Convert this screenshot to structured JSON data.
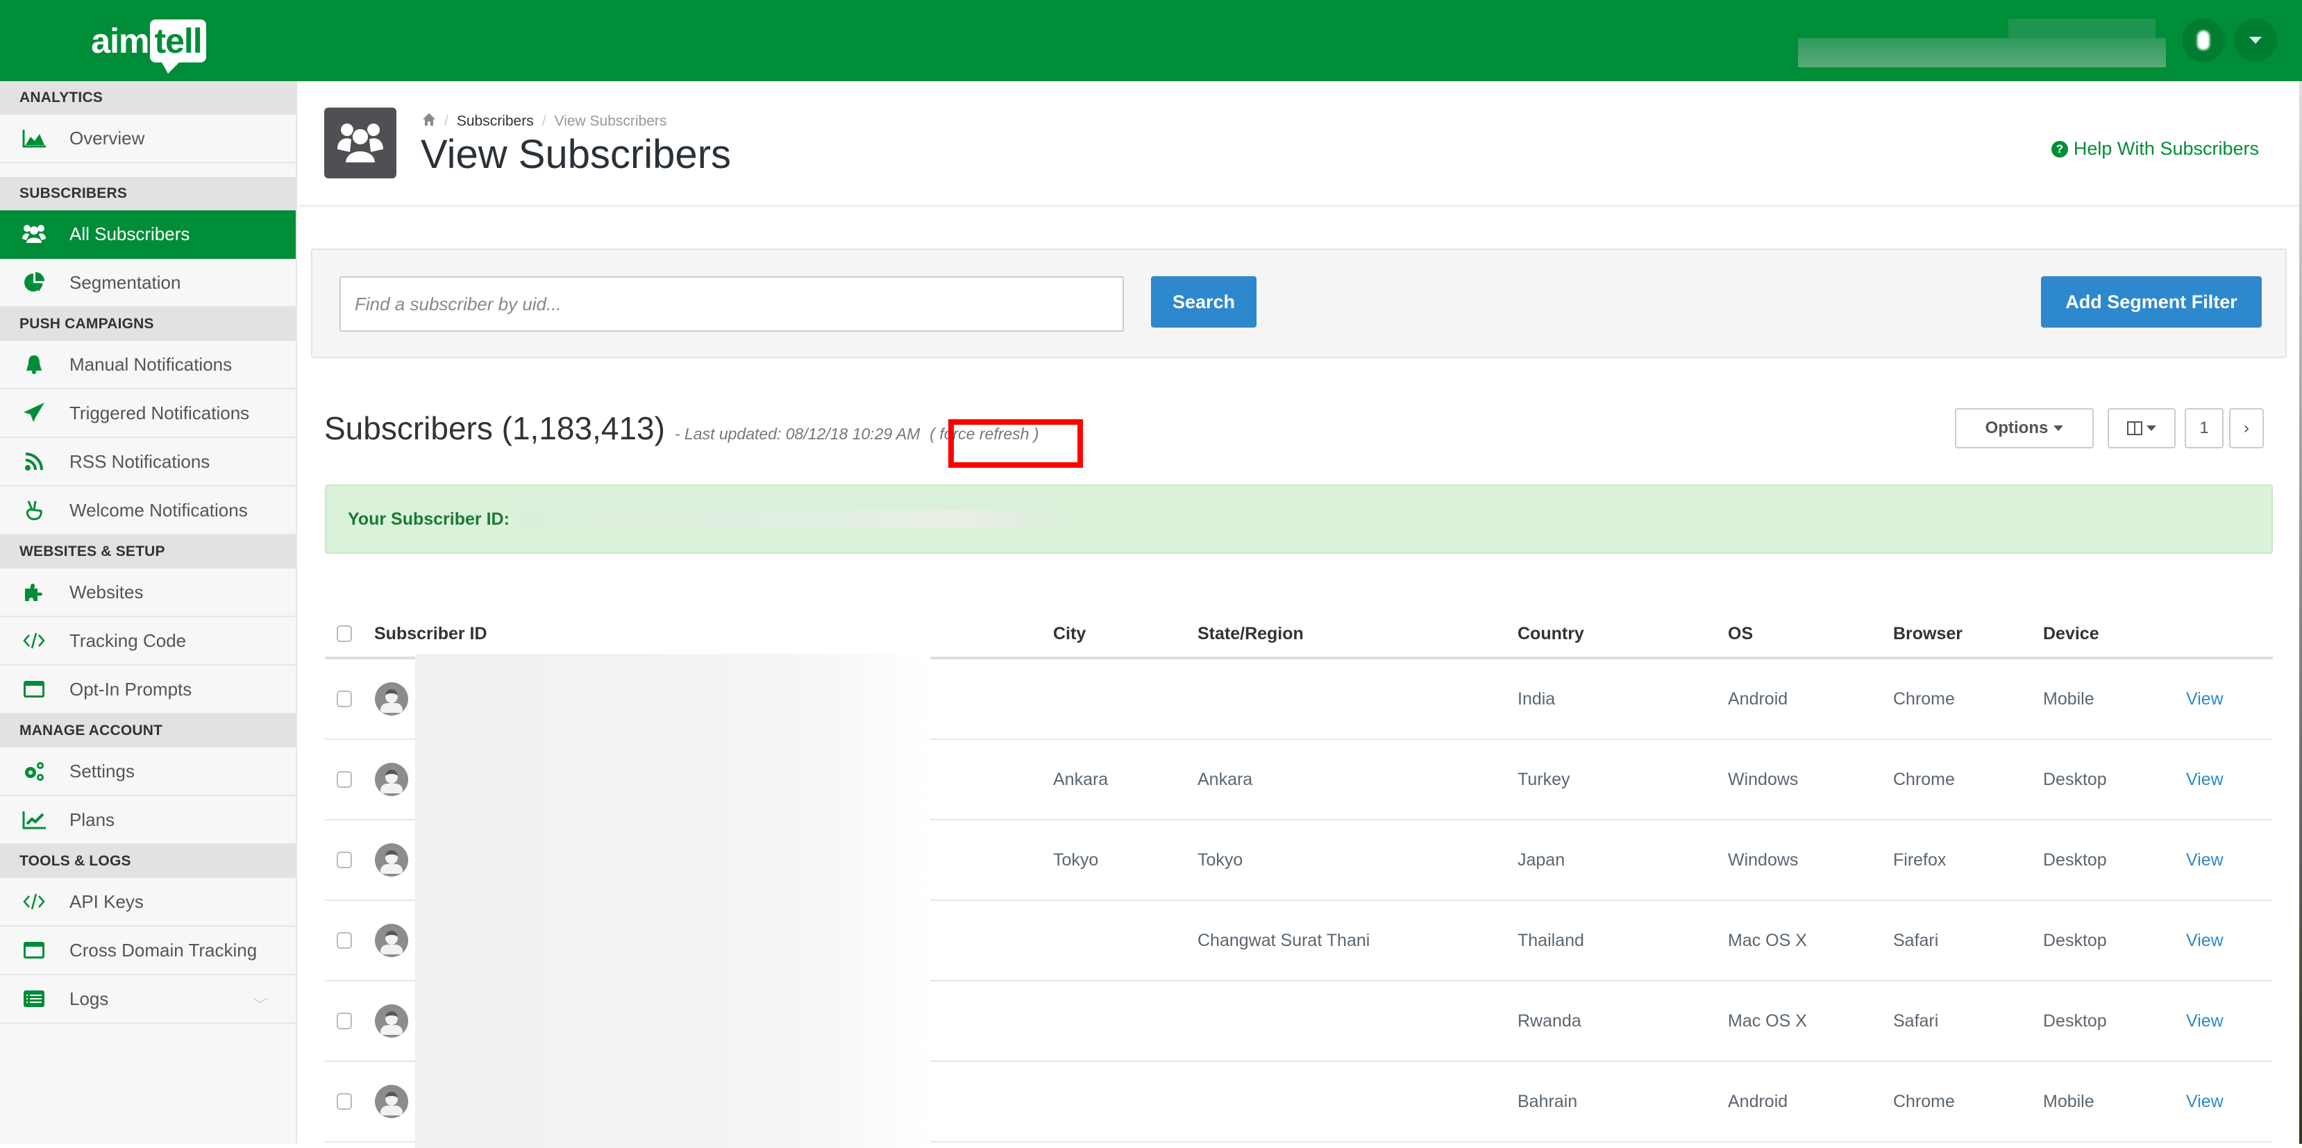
{
  "app": {
    "logo_prefix": "aim",
    "logo_suffix": "tell",
    "brand_color": "#008d38",
    "accent_blue": "#2e88ce"
  },
  "topbar": {
    "notifications_icon": "bell-icon",
    "user_menu_icon": "caret-down-icon"
  },
  "sidebar": {
    "sections": [
      {
        "title": "ANALYTICS",
        "items": [
          {
            "label": "Overview",
            "icon": "area-chart-icon"
          }
        ]
      },
      {
        "title": "SUBSCRIBERS",
        "items": [
          {
            "label": "All Subscribers",
            "icon": "users-icon",
            "active": true
          },
          {
            "label": "Segmentation",
            "icon": "pie-chart-icon"
          }
        ]
      },
      {
        "title": "PUSH CAMPAIGNS",
        "items": [
          {
            "label": "Manual Notifications",
            "icon": "bell-icon"
          },
          {
            "label": "Triggered Notifications",
            "icon": "paper-plane-icon"
          },
          {
            "label": "RSS Notifications",
            "icon": "rss-icon"
          },
          {
            "label": "Welcome Notifications",
            "icon": "peace-hand-icon"
          }
        ]
      },
      {
        "title": "WEBSITES & SETUP",
        "items": [
          {
            "label": "Websites",
            "icon": "puzzle-piece-icon"
          },
          {
            "label": "Tracking Code",
            "icon": "code-icon"
          },
          {
            "label": "Opt-In Prompts",
            "icon": "window-icon"
          }
        ]
      },
      {
        "title": "MANAGE ACCOUNT",
        "items": [
          {
            "label": "Settings",
            "icon": "cogs-icon"
          },
          {
            "label": "Plans",
            "icon": "line-chart-icon"
          }
        ]
      },
      {
        "title": "TOOLS & LOGS",
        "items": [
          {
            "label": "API Keys",
            "icon": "code-icon"
          },
          {
            "label": "Cross Domain Tracking",
            "icon": "window-icon"
          },
          {
            "label": "Logs",
            "icon": "list-icon",
            "expandable": true
          }
        ]
      }
    ]
  },
  "header": {
    "breadcrumb": [
      "Subscribers",
      "View Subscribers"
    ],
    "title": "View Subscribers",
    "help_label": "Help With Subscribers"
  },
  "filter": {
    "search_placeholder": "Find a subscriber by uid...",
    "search_value": "",
    "search_label": "Search",
    "add_segment_label": "Add Segment Filter"
  },
  "subscribers": {
    "title": "Subscribers (1,183,413)",
    "last_updated": "- Last updated: 08/12/18 10:29 AM",
    "force_refresh": "( force refresh )",
    "options_label": "Options",
    "current_page": "1",
    "next_label": "›"
  },
  "alert": {
    "label": "Your Subscriber ID:"
  },
  "table": {
    "columns": [
      "Subscriber ID",
      "City",
      "State/Region",
      "Country",
      "OS",
      "Browser",
      "Device"
    ],
    "rows": [
      {
        "city": "",
        "state": "",
        "country": "India",
        "os": "Android",
        "browser": "Chrome",
        "device": "Mobile",
        "action": "View"
      },
      {
        "city": "Ankara",
        "state": "Ankara",
        "country": "Turkey",
        "os": "Windows",
        "browser": "Chrome",
        "device": "Desktop",
        "action": "View"
      },
      {
        "city": "Tokyo",
        "state": "Tokyo",
        "country": "Japan",
        "os": "Windows",
        "browser": "Firefox",
        "device": "Desktop",
        "action": "View"
      },
      {
        "city": "",
        "state": "Changwat Surat Thani",
        "country": "Thailand",
        "os": "Mac OS X",
        "browser": "Safari",
        "device": "Desktop",
        "action": "View"
      },
      {
        "city": "",
        "state": "",
        "country": "Rwanda",
        "os": "Mac OS X",
        "browser": "Safari",
        "device": "Desktop",
        "action": "View"
      },
      {
        "city": "",
        "state": "",
        "country": "Bahrain",
        "os": "Android",
        "browser": "Chrome",
        "device": "Mobile",
        "action": "View"
      }
    ]
  }
}
